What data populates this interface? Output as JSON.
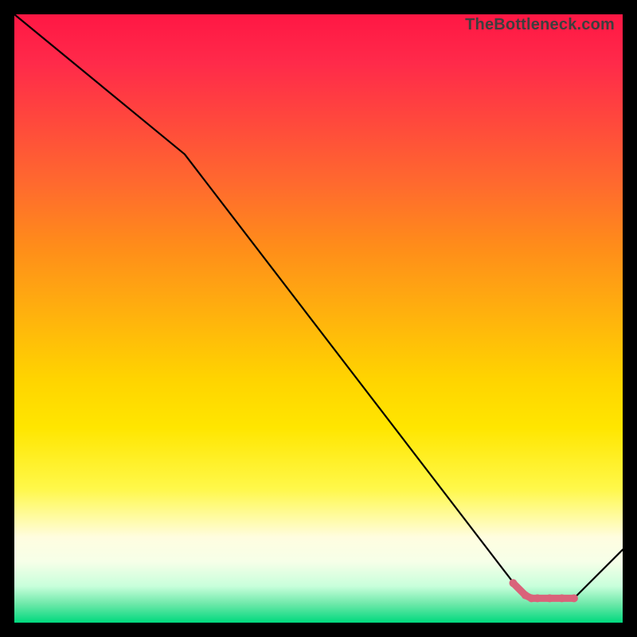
{
  "watermark": "TheBottleneck.com",
  "chart_data": {
    "type": "line",
    "title": "",
    "xlabel": "",
    "ylabel": "",
    "xlim": [
      0,
      100
    ],
    "ylim": [
      0,
      100
    ],
    "grid": false,
    "legend": false,
    "series": [
      {
        "name": "main-curve",
        "color": "#000000",
        "x": [
          0,
          28,
          84,
          92,
          100
        ],
        "values": [
          100,
          77,
          4,
          4,
          12
        ]
      },
      {
        "name": "highlight-segment",
        "color": "#d9637a",
        "x": [
          82,
          84,
          85,
          86,
          88,
          90,
          92
        ],
        "values": [
          6.5,
          4.5,
          4,
          4,
          4,
          4,
          4
        ]
      }
    ]
  }
}
